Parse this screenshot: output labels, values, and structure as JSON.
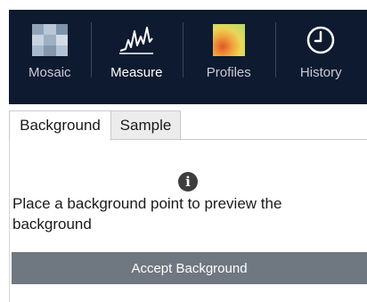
{
  "toolbar": {
    "items": [
      {
        "label": "Mosaic",
        "icon": "mosaic-icon"
      },
      {
        "label": "Measure",
        "icon": "spectrum-icon",
        "active": true
      },
      {
        "label": "Profiles",
        "icon": "heatmap-icon"
      },
      {
        "label": "History",
        "icon": "clock-icon"
      }
    ],
    "background_color": "#0e1a30"
  },
  "tabs": [
    {
      "label": "Background",
      "selected": true
    },
    {
      "label": "Sample",
      "selected": false
    }
  ],
  "panel": {
    "icon": "info-icon",
    "message": "Place a background point to preview the background",
    "button_label": "Accept Background",
    "button_color": "#6f7780"
  }
}
